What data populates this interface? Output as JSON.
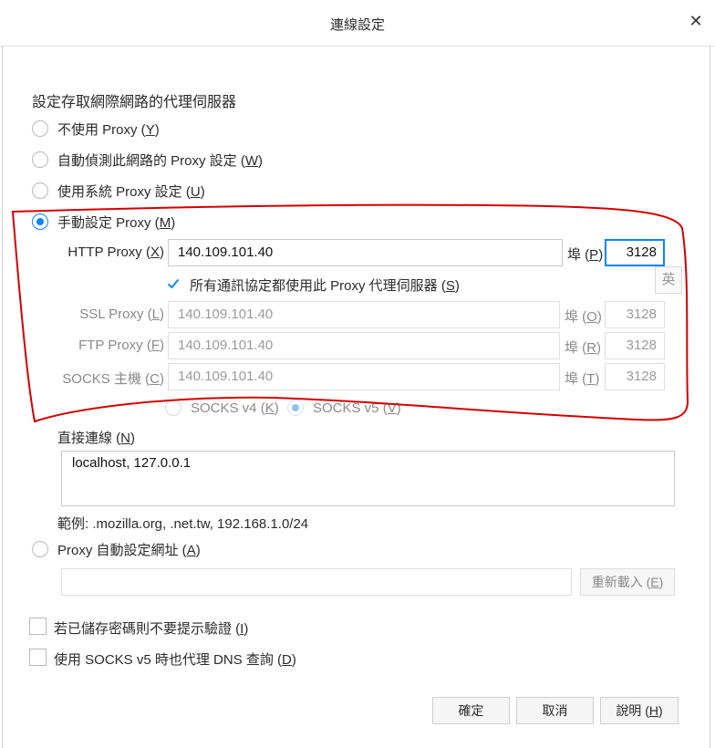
{
  "window": {
    "title": "連線設定",
    "close_glyph": "✕"
  },
  "section_title": "設定存取網際網路的代理伺服器",
  "proxy_modes": {
    "none": {
      "label": "不使用 Proxy (",
      "key": "Y",
      "end": ")"
    },
    "auto_detect": {
      "label": "自動偵測此網路的 Proxy 設定 (",
      "key": "W",
      "end": ")"
    },
    "system": {
      "label": "使用系統 Proxy 設定 (",
      "key": "U",
      "end": ")"
    },
    "manual": {
      "label": "手動設定 Proxy (",
      "key": "M",
      "end": ")"
    }
  },
  "manual": {
    "http": {
      "label": "HTTP Proxy (",
      "key": "X",
      "end": ")",
      "value": "140.109.101.40",
      "port_label": "埠 (",
      "port_key": "P",
      "port_end": ")",
      "port": "3128"
    },
    "share_all": {
      "label": "所有通訊協定都使用此 Proxy 代理伺服器 (",
      "key": "S",
      "end": ")",
      "checked": true
    },
    "ssl": {
      "label": "SSL Proxy (",
      "key": "L",
      "end": ")",
      "value": "140.109.101.40",
      "port_label": "埠 (",
      "port_key": "O",
      "port_end": ")",
      "port": "3128"
    },
    "ftp": {
      "label": "FTP Proxy (",
      "key": "F",
      "end": ")",
      "value": "140.109.101.40",
      "port_label": "埠 (",
      "port_key": "R",
      "port_end": ")",
      "port": "3128"
    },
    "socks": {
      "label": "SOCKS 主機 (",
      "key": "C",
      "end": ")",
      "value": "140.109.101.40",
      "port_label": "埠 (",
      "port_key": "T",
      "port_end": ")",
      "port": "3128"
    },
    "socks_v4": {
      "label": "SOCKS v4 (",
      "key": "K",
      "end": ")"
    },
    "socks_v5": {
      "label": "SOCKS v5 (",
      "key": "V",
      "end": ")"
    }
  },
  "ime_indicator": "英",
  "no_proxy": {
    "label": "直接連線 (",
    "key": "N",
    "end": ")",
    "value": "localhost, 127.0.0.1",
    "example": "範例: .mozilla.org, .net.tw, 192.168.1.0/24"
  },
  "auto_config": {
    "label": "Proxy 自動設定網址 (",
    "key": "A",
    "end": ")",
    "value": "",
    "reload_label": "重新載入 (",
    "reload_key": "E",
    "reload_end": ")"
  },
  "options": {
    "no_auth_prompt": {
      "label": "若已儲存密碼則不要提示驗證 (",
      "key": "I",
      "end": ")",
      "checked": false
    },
    "socks_dns": {
      "label": "使用 SOCKS v5 時也代理 DNS 查詢 (",
      "key": "D",
      "end": ")",
      "checked": false
    }
  },
  "buttons": {
    "ok": "確定",
    "cancel": "取消",
    "help": {
      "label": "說明 (",
      "key": "H",
      "end": ")"
    }
  },
  "colors": {
    "accent": "#0a84ff",
    "annotation": "#d40000"
  }
}
